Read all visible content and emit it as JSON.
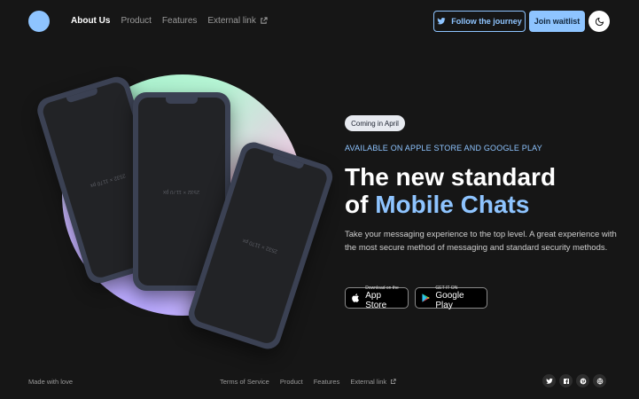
{
  "nav": {
    "links": [
      "About Us",
      "Product",
      "Features"
    ],
    "external_link": "External link",
    "follow_label": "Follow the journey",
    "join_label": "Join waitlist"
  },
  "hero": {
    "badge": "Coming in April",
    "kicker": "AVAILABLE ON APPLE STORE AND GOOGLE PLAY",
    "headline_line1": "The new standard",
    "headline_of": "of",
    "headline_accent": "Mobile Chats",
    "description": "Take your messaging experience to the top level. A great experience with the most secure method of messaging and standard security methods.",
    "phone_screen_text": "2532 × 1170 px",
    "app_store": {
      "small": "Download on the",
      "big": "App Store"
    },
    "google_play": {
      "small": "GET IT ON",
      "big": "Google Play"
    }
  },
  "footer": {
    "made_with": "Made with love",
    "links": [
      "Terms of Service",
      "Product",
      "Features"
    ],
    "external_link": "External link",
    "socials": [
      "twitter-icon",
      "facebook-icon",
      "pinterest-icon",
      "globe-icon"
    ]
  },
  "colors": {
    "background": "#161616",
    "accent": "#8ec4ff"
  }
}
